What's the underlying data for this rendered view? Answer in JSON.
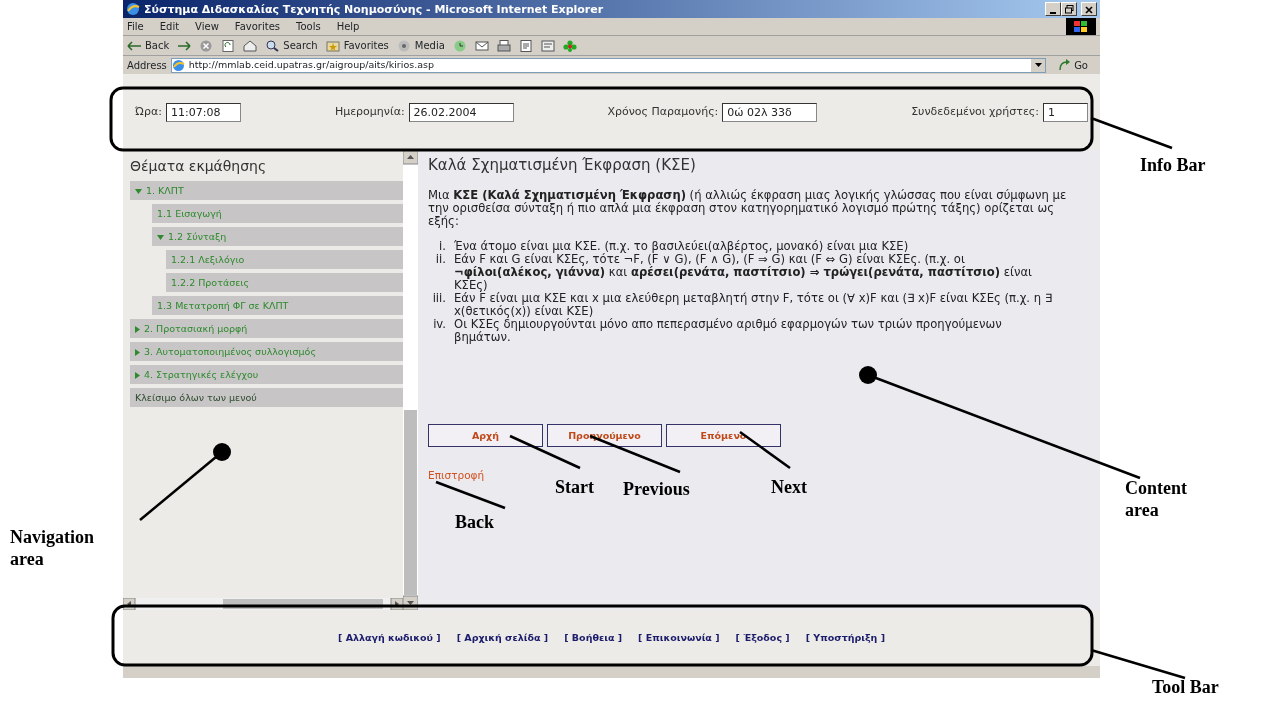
{
  "window": {
    "title": "Σύστημα Διδασκαλίας Τεχνητής Νοημοσύνης - Microsoft Internet Explorer"
  },
  "menu": [
    "File",
    "Edit",
    "View",
    "Favorites",
    "Tools",
    "Help"
  ],
  "toolbar": [
    {
      "kind": "back",
      "label": "Back"
    },
    {
      "kind": "forward"
    },
    {
      "kind": "stop"
    },
    {
      "kind": "refresh"
    },
    {
      "kind": "home"
    },
    {
      "kind": "search",
      "label": "Search"
    },
    {
      "kind": "favorites",
      "label": "Favorites"
    },
    {
      "kind": "media",
      "label": "Media"
    },
    {
      "kind": "history"
    },
    {
      "kind": "mail"
    },
    {
      "kind": "print"
    },
    {
      "kind": "edit"
    },
    {
      "kind": "discuss"
    },
    {
      "kind": "flower"
    }
  ],
  "address": {
    "label": "Address",
    "url": "http://mmlab.ceid.upatras.gr/aigroup/aits/kirios.asp",
    "go": "Go"
  },
  "info_bar": [
    {
      "label": "Ώρα:",
      "value": "11:07:08"
    },
    {
      "label": "Ημερομηνία:",
      "value": "26.02.2004"
    },
    {
      "label": "Χρόνος Παραμονής:",
      "value": "0ώ 02λ 33δ"
    },
    {
      "label": "Συνδεδεμένοι χρήστες:",
      "value": "1"
    }
  ],
  "navigation": {
    "title": "Θέματα εκμάθησης",
    "items": [
      {
        "kind": "group",
        "label": "1. ΚΛΠΤ",
        "expanded": true,
        "children": [
          {
            "kind": "page",
            "label": "1.1 Εισαγωγή"
          },
          {
            "kind": "group",
            "label": "1.2 Σύνταξη",
            "expanded": true,
            "children": [
              {
                "kind": "page",
                "label": "1.2.1 Λεξιλόγιο"
              },
              {
                "kind": "page",
                "label": "1.2.2 Προτάσεις"
              }
            ]
          },
          {
            "kind": "page",
            "label": "1.3 Μετατροπή ΦΓ σε ΚΛΠΤ"
          }
        ]
      },
      {
        "kind": "group",
        "label": "2. Προτασιακή μορφή",
        "expanded": false
      },
      {
        "kind": "group",
        "label": "3. Αυτοματοποιημένος συλλογισμός",
        "expanded": false
      },
      {
        "kind": "group",
        "label": "4. Στρατηγικές ελέγχου",
        "expanded": false
      },
      {
        "kind": "action",
        "label": "Κλείσιμο όλων των μενού"
      }
    ]
  },
  "content": {
    "title": "Καλά Σχηματισμένη Έκφραση (ΚΣΕ)",
    "paragraph": "Μια **ΚΣΕ (Καλά Σχηματισμένη Έκφραση)** (ή αλλιώς έκφραση μιας λογικής γλώσσας που είναι σύμφωνη με την ορισθείσα σύνταξη ή πιο απλά μια έκφραση στον κατηγορηματικό λογισμό πρώτης τάξης) ορίζεται ως εξής:",
    "list": [
      {
        "marker": "i.",
        "text": "Ένα άτομο είναι μια ΚΣΕ. (π.χ. το βασιλεύει(αλβέρτος, μονακό) είναι μια ΚΣΕ)"
      },
      {
        "marker": "ii.",
        "text": "Εάν F και G είναι ΚΣΕς, τότε ¬F, (F ∨ G), (F ∧ G), (F ⇒ G) και (F ⇔ G) είναι ΚΣΕς. (π.χ. οι **¬φίλοι(αλέκος, γιάννα)** και **αρέσει(ρενάτα, παστίτσιο) ⇒ τρώγει(ρενάτα, παστίτσιο)** είναι ΚΣΕς)"
      },
      {
        "marker": "iii.",
        "text": "Εάν F είναι μια ΚΣΕ και x μια ελεύθερη μεταβλητή στην F, τότε οι (∀ x)F και (∃ x)F είναι ΚΣΕς (π.χ. η ∃ x(θετικός(x)) είναι ΚΣΕ)"
      },
      {
        "marker": "iv.",
        "text": "Οι ΚΣΕς δημιουργούνται μόνο απο πεπερασμένο αριθμό εφαρμογών των τριών προηγούμενων βημάτων."
      }
    ],
    "buttons": [
      "Αρχή",
      "Προηγούμενο",
      "Επόμενο"
    ],
    "back_link": "Επιστροφή"
  },
  "footer_links": [
    "[ Αλλαγή κωδικού ]",
    "[ Αρχική σελίδα ]",
    "[ Βοήθεια ]",
    "[ Επικοινωνία ]",
    "[ Έξοδος ]",
    "[ Υποστήριξη ]"
  ],
  "annotations": [
    {
      "kind": "box",
      "label": "Info Bar"
    },
    {
      "kind": "pointer",
      "label": "Start"
    },
    {
      "kind": "pointer",
      "label": "Previous"
    },
    {
      "kind": "pointer",
      "label": "Next"
    },
    {
      "kind": "pointer",
      "label": "Content area"
    },
    {
      "kind": "pointer",
      "label": "Back"
    },
    {
      "kind": "pointer",
      "label": "Navigation area"
    },
    {
      "kind": "box",
      "label": "Tool Bar"
    }
  ]
}
